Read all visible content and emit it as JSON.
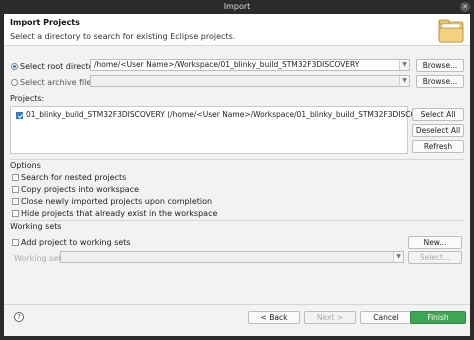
{
  "window": {
    "title": "Import",
    "close_icon": "close-icon"
  },
  "header": {
    "title": "Import Projects",
    "subtitle": "Select a directory to search for existing Eclipse projects.",
    "icon": "folder-icon"
  },
  "root_dir": {
    "label": "Select root directory:",
    "value": "/home/<User Name>/Workspace/01_blinky_build_STM32F3DISCOVERY",
    "browse": "Browse...",
    "selected": true
  },
  "archive": {
    "label": "Select archive file:",
    "value": "",
    "browse": "Browse...",
    "selected": false
  },
  "projects": {
    "label": "Projects:",
    "items": [
      {
        "label": "01_blinky_build_STM32F3DISCOVERY (/home/<User Name>/Workspace/01_blinky_build_STM32F3DISCOVERY)",
        "checked": true
      }
    ],
    "select_all": "Select All",
    "deselect_all": "Deselect All",
    "refresh": "Refresh"
  },
  "options": {
    "label": "Options",
    "items": [
      {
        "label": "Search for nested projects",
        "checked": false
      },
      {
        "label": "Copy projects into workspace",
        "checked": false
      },
      {
        "label": "Close newly imported projects upon completion",
        "checked": false
      },
      {
        "label": "Hide projects that already exist in the workspace",
        "checked": false
      }
    ]
  },
  "working_sets": {
    "label": "Working sets",
    "add_label": "Add project to working sets",
    "new_button": "New...",
    "sets_label": "Working sets:",
    "sets_value": "",
    "select_button": "Select..."
  },
  "footer": {
    "help": "?",
    "back": "< Back",
    "next": "Next >",
    "cancel": "Cancel",
    "finish": "Finish"
  }
}
